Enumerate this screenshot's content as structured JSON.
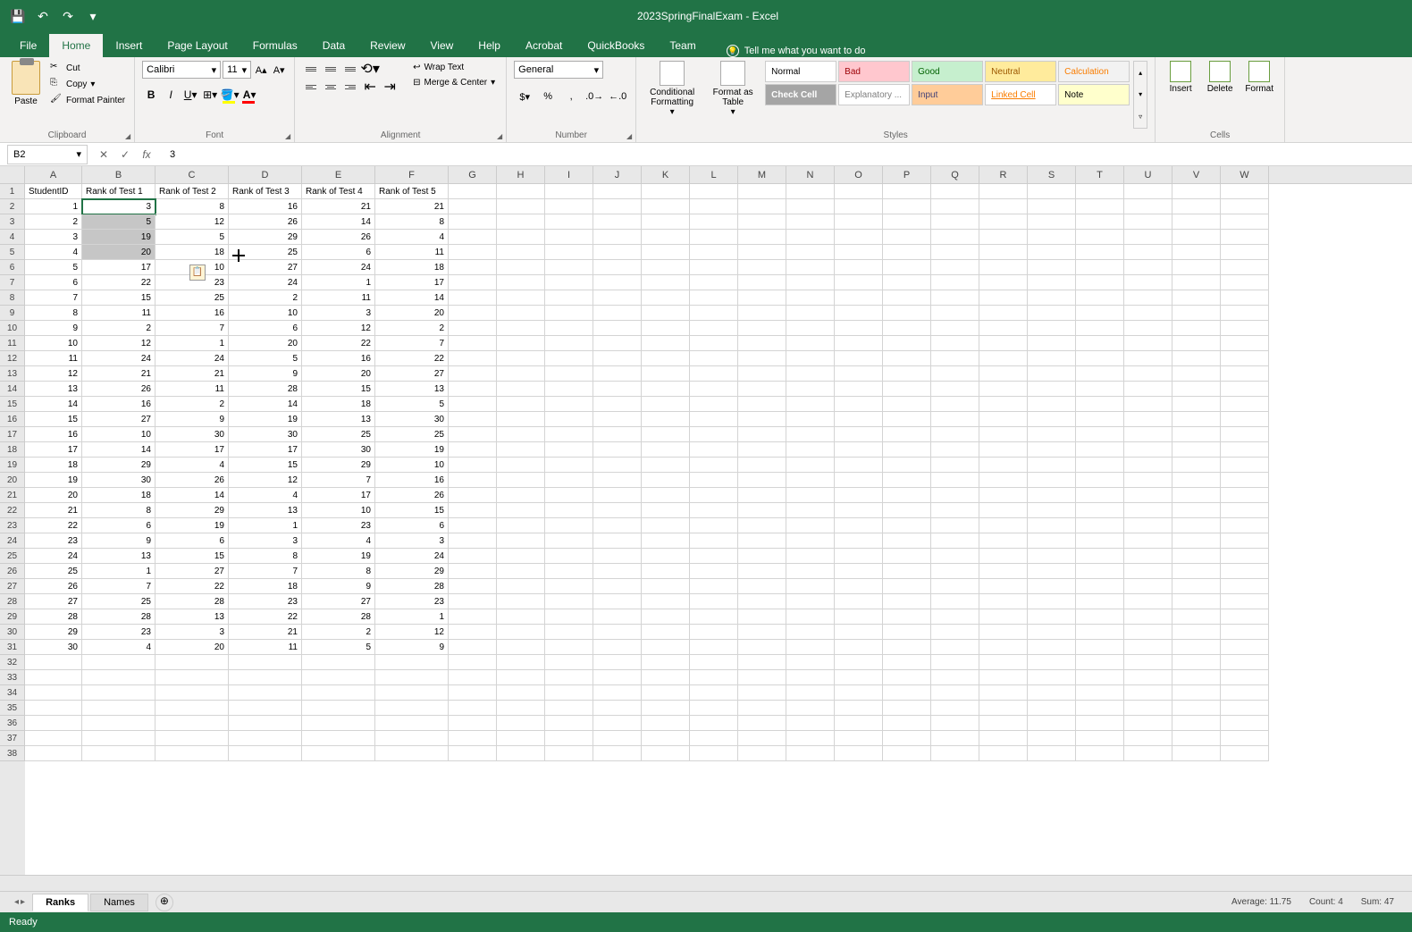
{
  "app_title": "2023SpringFinalExam - Excel",
  "qat": {
    "save": "💾",
    "undo": "↶",
    "redo": "↷",
    "more": "▾"
  },
  "tabs": [
    "File",
    "Home",
    "Insert",
    "Page Layout",
    "Formulas",
    "Data",
    "Review",
    "View",
    "Help",
    "Acrobat",
    "QuickBooks",
    "Team"
  ],
  "active_tab": "Home",
  "tell_me": "Tell me what you want to do",
  "ribbon": {
    "clipboard": {
      "paste": "Paste",
      "cut": "Cut",
      "copy": "Copy",
      "painter": "Format Painter",
      "label": "Clipboard"
    },
    "font": {
      "name": "Calibri",
      "size": "11",
      "label": "Font"
    },
    "alignment": {
      "wrap": "Wrap Text",
      "merge": "Merge & Center",
      "label": "Alignment"
    },
    "number": {
      "format": "General",
      "label": "Number"
    },
    "styles": {
      "cond": "Conditional Formatting",
      "fat": "Format as Table",
      "cells": [
        {
          "t": "Normal",
          "bg": "#ffffff",
          "c": "#000"
        },
        {
          "t": "Bad",
          "bg": "#ffc7ce",
          "c": "#9c0006"
        },
        {
          "t": "Good",
          "bg": "#c6efce",
          "c": "#006100"
        },
        {
          "t": "Neutral",
          "bg": "#ffeb9c",
          "c": "#9c5700"
        },
        {
          "t": "Calculation",
          "bg": "#f2f2f2",
          "c": "#fa7d00"
        },
        {
          "t": "Check Cell",
          "bg": "#a5a5a5",
          "c": "#ffffff"
        },
        {
          "t": "Explanatory ...",
          "bg": "#ffffff",
          "c": "#7f7f7f"
        },
        {
          "t": "Input",
          "bg": "#ffcc99",
          "c": "#3f3f76"
        },
        {
          "t": "Linked Cell",
          "bg": "#ffffff",
          "c": "#fa7d00"
        },
        {
          "t": "Note",
          "bg": "#ffffcc",
          "c": "#000"
        }
      ],
      "label": "Styles"
    },
    "cells_grp": {
      "insert": "Insert",
      "delete": "Delete",
      "format": "Format",
      "label": "Cells"
    }
  },
  "name_box": "B2",
  "formula_value": "3",
  "columns": [
    "A",
    "B",
    "C",
    "D",
    "E",
    "F",
    "G",
    "H",
    "I",
    "J",
    "K",
    "L",
    "M",
    "N",
    "O",
    "P",
    "Q",
    "R",
    "S",
    "T",
    "U",
    "V",
    "W"
  ],
  "headers": [
    "StudentID",
    "Rank of Test 1",
    "Rank of Test 2",
    "Rank of Test 3",
    "Rank of Test 4",
    "Rank of Test 5"
  ],
  "chart_data": {
    "type": "table",
    "columns": [
      "StudentID",
      "Rank of Test 1",
      "Rank of Test 2",
      "Rank of Test 3",
      "Rank of Test 4",
      "Rank of Test 5"
    ],
    "rows": [
      [
        1,
        3,
        8,
        16,
        21,
        21
      ],
      [
        2,
        5,
        12,
        26,
        14,
        8
      ],
      [
        3,
        19,
        5,
        29,
        26,
        4
      ],
      [
        4,
        20,
        18,
        25,
        6,
        11
      ],
      [
        5,
        17,
        10,
        27,
        24,
        18
      ],
      [
        6,
        22,
        23,
        24,
        1,
        17
      ],
      [
        7,
        15,
        25,
        2,
        11,
        14
      ],
      [
        8,
        11,
        16,
        10,
        3,
        20
      ],
      [
        9,
        2,
        7,
        6,
        12,
        2
      ],
      [
        10,
        12,
        1,
        20,
        22,
        7
      ],
      [
        11,
        24,
        24,
        5,
        16,
        22
      ],
      [
        12,
        21,
        21,
        9,
        20,
        27
      ],
      [
        13,
        26,
        11,
        28,
        15,
        13
      ],
      [
        14,
        16,
        2,
        14,
        18,
        5
      ],
      [
        15,
        27,
        9,
        19,
        13,
        30
      ],
      [
        16,
        10,
        30,
        30,
        25,
        25
      ],
      [
        17,
        14,
        17,
        17,
        30,
        19
      ],
      [
        18,
        29,
        4,
        15,
        29,
        10
      ],
      [
        19,
        30,
        26,
        12,
        7,
        16
      ],
      [
        20,
        18,
        14,
        4,
        17,
        26
      ],
      [
        21,
        8,
        29,
        13,
        10,
        15
      ],
      [
        22,
        6,
        19,
        1,
        23,
        6
      ],
      [
        23,
        9,
        6,
        3,
        4,
        3
      ],
      [
        24,
        13,
        15,
        8,
        19,
        24
      ],
      [
        25,
        1,
        27,
        7,
        8,
        29
      ],
      [
        26,
        7,
        22,
        18,
        9,
        28
      ],
      [
        27,
        25,
        28,
        23,
        27,
        23
      ],
      [
        28,
        28,
        13,
        22,
        28,
        1
      ],
      [
        29,
        23,
        3,
        21,
        2,
        12
      ],
      [
        30,
        4,
        20,
        11,
        5,
        9
      ]
    ]
  },
  "selection": {
    "active": "B2",
    "range": "B2:B5"
  },
  "sheets": [
    "Ranks",
    "Names"
  ],
  "active_sheet": "Ranks",
  "status": {
    "ready": "Ready",
    "avg_label": "Average:",
    "avg": "11.75",
    "count_label": "Count:",
    "count": "4",
    "sum_label": "Sum:",
    "sum": "47"
  },
  "row_count": 38
}
